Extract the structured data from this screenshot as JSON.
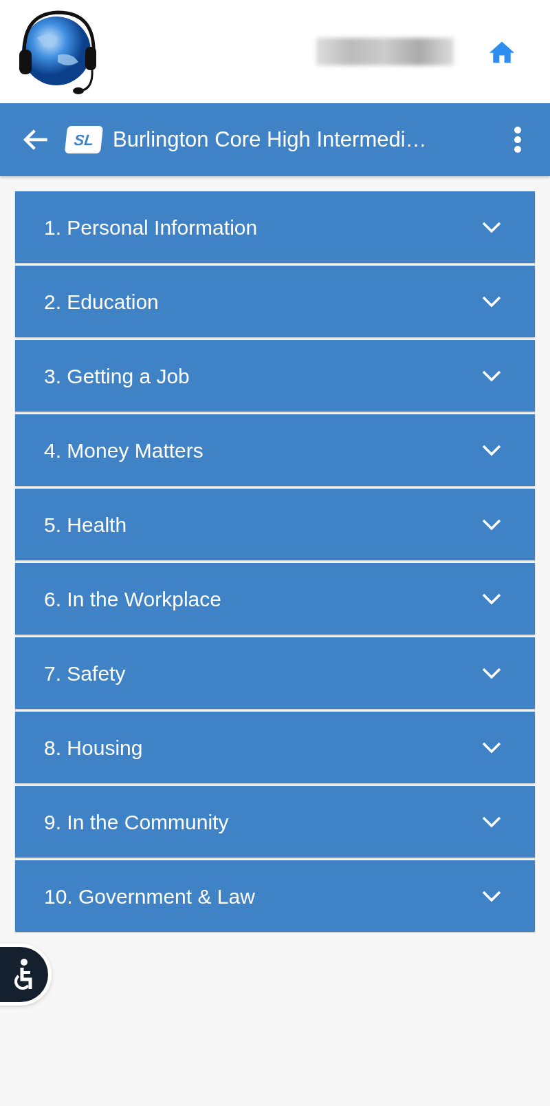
{
  "toolbar": {
    "badge": "SL",
    "title": "Burlington Core High Intermedi…"
  },
  "sections": [
    {
      "label": "1. Personal Information",
      "expanded": false
    },
    {
      "label": "2. Education",
      "expanded": false
    },
    {
      "label": "3. Getting a Job",
      "expanded": false
    },
    {
      "label": "4. Money Matters",
      "expanded": false
    },
    {
      "label": "5. Health",
      "expanded": false
    },
    {
      "label": "6. In the Workplace",
      "expanded": false
    },
    {
      "label": "7. Safety",
      "expanded": false
    },
    {
      "label": "8. Housing",
      "expanded": false
    },
    {
      "label": "9. In the Community",
      "expanded": false
    },
    {
      "label": "10. Government & Law",
      "expanded": false
    }
  ]
}
